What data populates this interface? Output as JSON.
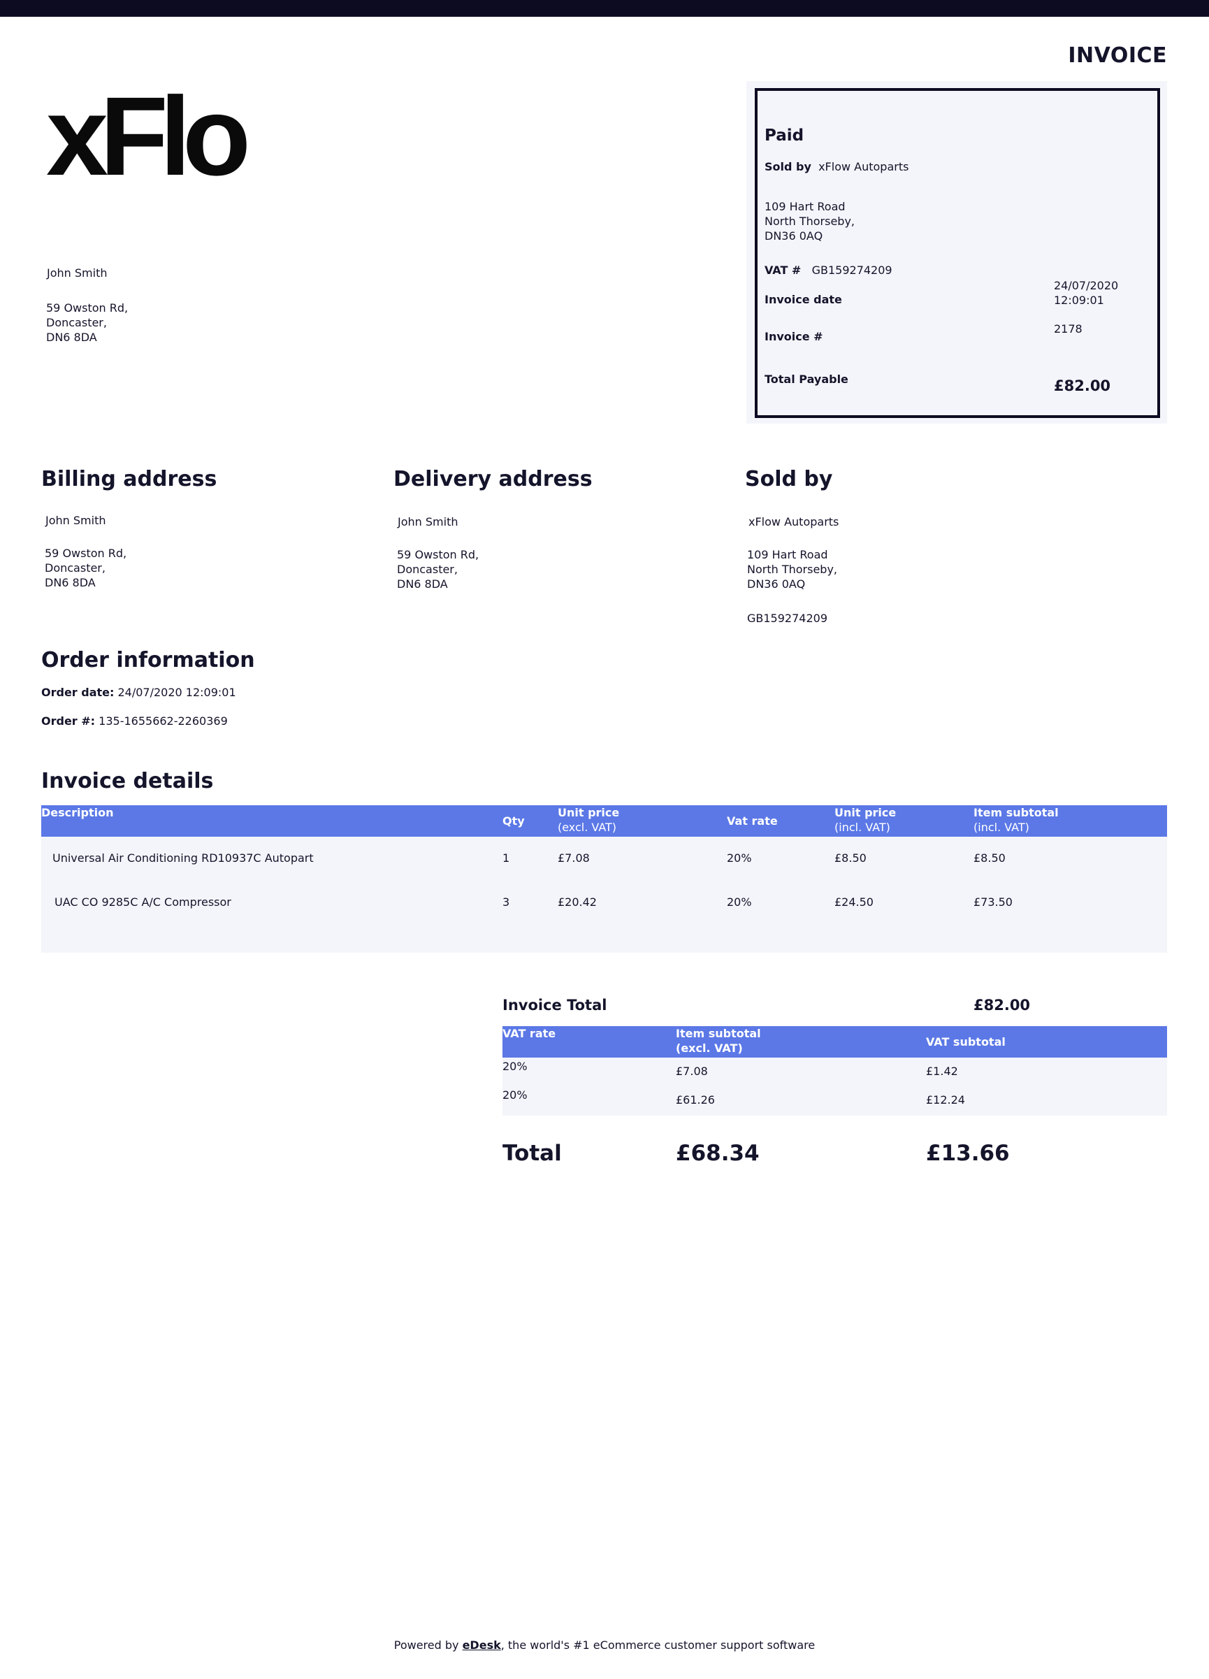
{
  "document": {
    "title": "INVOICE",
    "logo_text": "xFlo"
  },
  "customer": {
    "name": "John Smith",
    "address_lines": [
      "59 Owston Rd,",
      "Doncaster,",
      "DN6 8DA"
    ]
  },
  "summary": {
    "status": "Paid",
    "sold_by_label": "Sold by",
    "sold_by_value": "xFlow Autoparts",
    "address_lines": [
      "109 Hart Road",
      "North Thorseby,",
      "DN36 0AQ"
    ],
    "vat_label": "VAT #",
    "vat_value": "GB159274209",
    "invoice_date_label": "Invoice date",
    "invoice_date_lines": [
      "24/07/2020",
      "12:09:01"
    ],
    "invoice_no_label": "Invoice #",
    "invoice_no_value": "2178",
    "total_payable_label": "Total Payable",
    "total_payable_value": "£82.00"
  },
  "billing": {
    "heading": "Billing address",
    "name": "John Smith",
    "address_lines": [
      "59 Owston Rd,",
      "Doncaster,",
      "DN6 8DA"
    ]
  },
  "delivery": {
    "heading": "Delivery address",
    "name": "John Smith",
    "address_lines": [
      "59 Owston Rd,",
      "Doncaster,",
      "DN6 8DA"
    ]
  },
  "seller": {
    "heading": "Sold by",
    "name": "xFlow Autoparts",
    "address_lines": [
      "109 Hart Road",
      "North Thorseby,",
      "DN36 0AQ"
    ],
    "vat": "GB159274209"
  },
  "order": {
    "heading": "Order information",
    "date_label": "Order date:",
    "date_value": "24/07/2020 12:09:01",
    "number_label": "Order #:",
    "number_value": "135-1655662-2260369"
  },
  "invoice_details": {
    "heading": "Invoice details",
    "columns": [
      {
        "line1": "Description",
        "line2": ""
      },
      {
        "line1": "Qty",
        "line2": ""
      },
      {
        "line1": "Unit price",
        "line2": "(excl. VAT)"
      },
      {
        "line1": "Vat rate",
        "line2": ""
      },
      {
        "line1": "Unit price",
        "line2": "(incl. VAT)"
      },
      {
        "line1": "Item subtotal",
        "line2": "(incl. VAT)"
      }
    ],
    "rows": [
      {
        "description": "Universal Air Conditioning RD10937C Autopart",
        "qty": "1",
        "unit_excl": "£7.08",
        "vat_rate": "20%",
        "unit_incl": "£8.50",
        "subtotal": "£8.50"
      },
      {
        "description": "UAC CO 9285C A/C Compressor",
        "qty": "3",
        "unit_excl": "£20.42",
        "vat_rate": "20%",
        "unit_incl": "£24.50",
        "subtotal": "£73.50"
      }
    ]
  },
  "totals": {
    "invoice_total_label": "Invoice Total",
    "invoice_total_value": "£82.00",
    "vat_columns": [
      {
        "line1": "VAT rate",
        "line2": ""
      },
      {
        "line1": "Item subtotal",
        "line2": "(excl. VAT)"
      },
      {
        "line1": "VAT subtotal",
        "line2": ""
      }
    ],
    "vat_rows": [
      {
        "rate": "20%",
        "subtotal_excl": "£7.08",
        "vat_subtotal": "£1.42"
      },
      {
        "rate": "20%",
        "subtotal_excl": "£61.26",
        "vat_subtotal": "£12.24"
      }
    ],
    "total_label": "Total",
    "total_excl": "£68.34",
    "total_vat": "£13.66"
  },
  "footer": {
    "prefix": "Powered by ",
    "brand": "eDesk",
    "suffix": ", the world's #1 eCommerce customer support software"
  }
}
